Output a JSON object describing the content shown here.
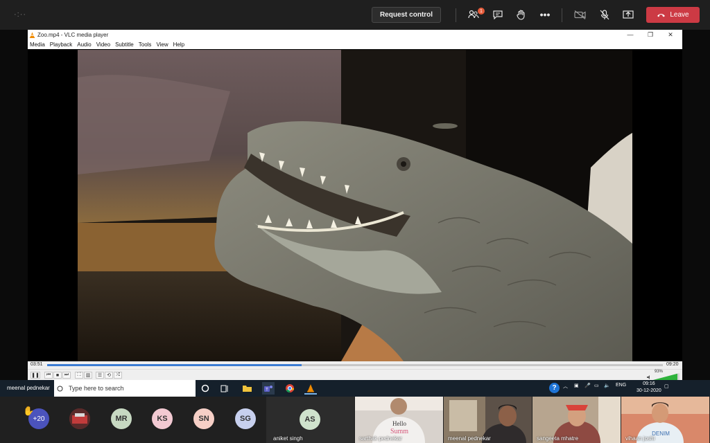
{
  "top_bar": {
    "dots": "·:··",
    "request_control_label": "Request control",
    "badge_count": "1",
    "leave_label": "Leave",
    "icons": [
      "participants-icon",
      "chat-icon",
      "raise-hand-icon",
      "more-icon",
      "camera-off-icon",
      "mic-off-icon",
      "share-icon"
    ]
  },
  "vlc": {
    "title": "Zoo.mp4 - VLC media player",
    "menu": [
      "Media",
      "Playback",
      "Audio",
      "Video",
      "Subtitle",
      "Tools",
      "View",
      "Help"
    ],
    "elapsed": "03:51",
    "total": "09:20",
    "progress_fraction": 0.413,
    "volume": "93%"
  },
  "taskbar": {
    "presenter_name": "meenal pednekar",
    "search_placeholder": "Type here to search",
    "lang": "ENG",
    "time": "09:16",
    "date": "30-12-2020"
  },
  "gallery": {
    "more_count": "+20",
    "avatars": [
      {
        "initials": "MR",
        "color": "#c7d9c2"
      },
      {
        "initials": "KS",
        "color": "#f2c9d2"
      },
      {
        "initials": "SN",
        "color": "#f6cfc6"
      },
      {
        "initials": "SG",
        "color": "#c7d0ee"
      },
      {
        "initials": "AS",
        "color": "#cfe3cc"
      }
    ],
    "aniket_name": "aniket singh",
    "tiles": [
      {
        "name": "sarthak pednekar",
        "shirt_text": "Hello Summer"
      },
      {
        "name": "meenal pednekar"
      },
      {
        "name": "sangeeta mhatre"
      },
      {
        "name": "vihaan joshi",
        "shirt_text": "DENIM"
      }
    ]
  }
}
